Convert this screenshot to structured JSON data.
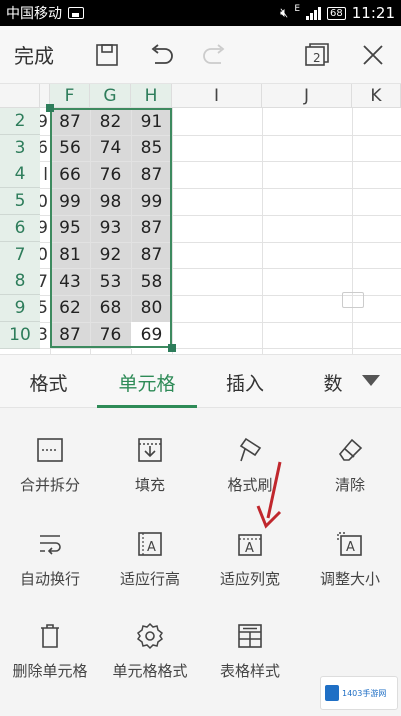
{
  "status_bar": {
    "carrier": "中国移动",
    "signal_label": "E",
    "battery": "68",
    "time": "11:21"
  },
  "toolbar": {
    "done_label": "完成",
    "page_count": "2"
  },
  "sheet": {
    "columns": [
      "F",
      "G",
      "H",
      "I",
      "J",
      "K"
    ],
    "rows": [
      {
        "num": "2",
        "e": "9",
        "f": "87",
        "g": "82",
        "h": "91"
      },
      {
        "num": "3",
        "e": "6",
        "f": "56",
        "g": "74",
        "h": "85"
      },
      {
        "num": "4",
        "e": "l",
        "f": "66",
        "g": "76",
        "h": "87"
      },
      {
        "num": "5",
        "e": "0",
        "f": "99",
        "g": "98",
        "h": "99"
      },
      {
        "num": "6",
        "e": "9",
        "f": "95",
        "g": "93",
        "h": "87"
      },
      {
        "num": "7",
        "e": "0",
        "f": "81",
        "g": "92",
        "h": "87"
      },
      {
        "num": "8",
        "e": "7",
        "f": "43",
        "g": "53",
        "h": "58"
      },
      {
        "num": "9",
        "e": "5",
        "f": "62",
        "g": "68",
        "h": "80"
      },
      {
        "num": "10",
        "e": "3",
        "f": "87",
        "g": "76",
        "h": "69"
      }
    ]
  },
  "tabs": [
    {
      "label": "格式"
    },
    {
      "label": "单元格"
    },
    {
      "label": "插入"
    },
    {
      "label": "数"
    }
  ],
  "tools": [
    {
      "label": "合并拆分",
      "icon": "merge-icon"
    },
    {
      "label": "填充",
      "icon": "fill-icon"
    },
    {
      "label": "格式刷",
      "icon": "format-brush-icon"
    },
    {
      "label": "清除",
      "icon": "eraser-icon"
    },
    {
      "label": "自动换行",
      "icon": "wrap-text-icon"
    },
    {
      "label": "适应行高",
      "icon": "fit-row-height-icon"
    },
    {
      "label": "适应列宽",
      "icon": "fit-column-width-icon"
    },
    {
      "label": "调整大小",
      "icon": "resize-icon"
    },
    {
      "label": "删除单元格",
      "icon": "trash-icon"
    },
    {
      "label": "单元格格式",
      "icon": "gear-icon"
    },
    {
      "label": "表格样式",
      "icon": "table-style-icon"
    }
  ],
  "watermark": {
    "text": "1403手游网"
  },
  "colors": {
    "accent": "#2e8b57",
    "selection": "#d9d9d9",
    "annotation": "#c0272d"
  }
}
